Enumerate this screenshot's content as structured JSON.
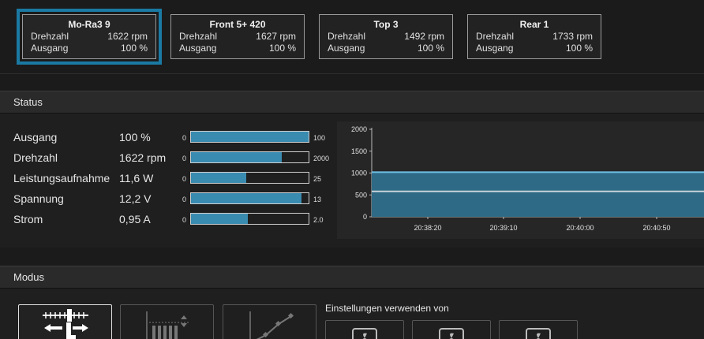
{
  "fans": [
    {
      "name": "Mo-Ra3 9",
      "speed_label": "Drehzahl",
      "speed": "1622 rpm",
      "output_label": "Ausgang",
      "output": "100 %",
      "selected": true
    },
    {
      "name": "Front 5+ 420",
      "speed_label": "Drehzahl",
      "speed": "1627 rpm",
      "output_label": "Ausgang",
      "output": "100 %",
      "selected": false
    },
    {
      "name": "Top 3",
      "speed_label": "Drehzahl",
      "speed": "1492 rpm",
      "output_label": "Ausgang",
      "output": "100 %",
      "selected": false
    },
    {
      "name": "Rear 1",
      "speed_label": "Drehzahl",
      "speed": "1733 rpm",
      "output_label": "Ausgang",
      "output": "100 %",
      "selected": false
    }
  ],
  "status": {
    "title": "Status",
    "rows": [
      {
        "label": "Ausgang",
        "value": "100 %",
        "min": "0",
        "max": "100",
        "fraction": 1.0
      },
      {
        "label": "Drehzahl",
        "value": "1622 rpm",
        "min": "0",
        "max": "2000",
        "fraction": 0.77
      },
      {
        "label": "Leistungsaufnahme",
        "value": "11,6 W",
        "min": "0",
        "max": "25",
        "fraction": 0.47
      },
      {
        "label": "Spannung",
        "value": "12,2 V",
        "min": "0",
        "max": "13",
        "fraction": 0.94
      },
      {
        "label": "Strom",
        "value": "0,95 A",
        "min": "0",
        "max": "2.0",
        "fraction": 0.48
      }
    ]
  },
  "chart_data": {
    "type": "area",
    "title": "",
    "xlabel": "",
    "ylabel": "",
    "ylim": [
      0,
      2000
    ],
    "y_ticks": [
      "0",
      "500",
      "1000",
      "1500",
      "2000"
    ],
    "x_ticks": [
      "20:38:20",
      "20:39:10",
      "20:40:00",
      "20:40:50"
    ],
    "series": [
      {
        "values": [
          1020,
          1020,
          1020,
          1020,
          1020
        ]
      },
      {
        "values": [
          580,
          580,
          580,
          580,
          580
        ]
      }
    ],
    "grid": false,
    "colors": {
      "area": "#2e6a86",
      "line_top": "#6fc0e6",
      "line_mid": "#c8d3d8"
    }
  },
  "modus": {
    "title": "Modus",
    "use_settings_label": "Einstellungen verwenden von"
  },
  "colors": {
    "accent": "#1a7aa3",
    "bar": "#3a8bb0"
  }
}
